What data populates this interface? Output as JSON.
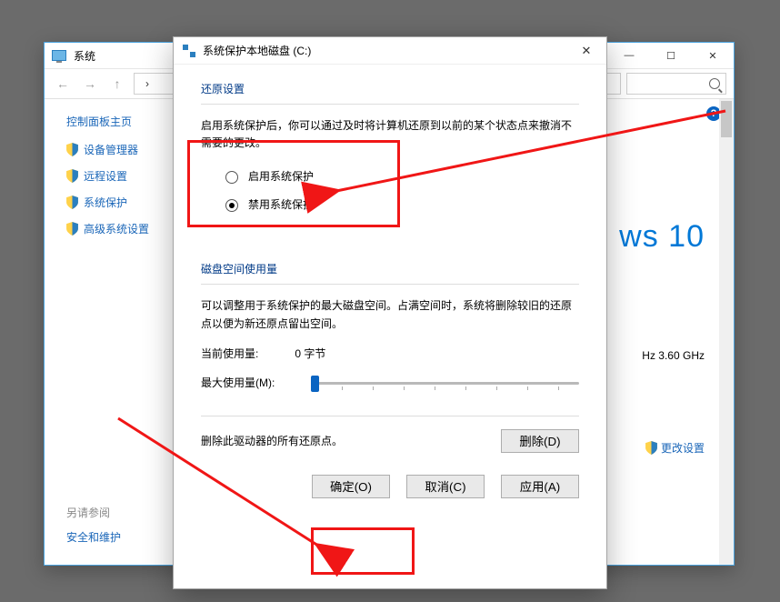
{
  "system_window": {
    "title": "系统",
    "breadcrumb_sep": "›",
    "win_buttons": {
      "min": "—",
      "max": "☐",
      "close": "✕"
    },
    "sidebar": {
      "home": "控制面板主页",
      "links": [
        {
          "label": "设备管理器"
        },
        {
          "label": "远程设置"
        },
        {
          "label": "系统保护"
        },
        {
          "label": "高级系统设置"
        }
      ],
      "see_also": "另请参阅",
      "see_also_link": "安全和维护"
    },
    "content": {
      "windows_logo_fragment": "ws 10",
      "cpu_fragment": "Hz   3.60 GHz",
      "change_settings": "更改设置"
    }
  },
  "dialog": {
    "title": "系统保护本地磁盘 (C:)",
    "close": "✕",
    "section_restore": "还原设置",
    "restore_desc": "启用系统保护后，你可以通过及时将计算机还原到以前的某个状态点来撤消不需要的更改。",
    "radio_enable": "启用系统保护",
    "radio_disable": "禁用系统保护",
    "radio_selected": "disable",
    "section_disk": "磁盘空间使用量",
    "disk_desc": "可以调整用于系统保护的最大磁盘空间。占满空间时，系统将删除较旧的还原点以便为新还原点留出空间。",
    "current_label": "当前使用量:",
    "current_value": "0 字节",
    "max_label": "最大使用量(M):",
    "slider_value": 0,
    "delete_desc": "删除此驱动器的所有还原点。",
    "btn_delete": "删除(D)",
    "btn_ok": "确定(O)",
    "btn_cancel": "取消(C)",
    "btn_apply": "应用(A)"
  }
}
